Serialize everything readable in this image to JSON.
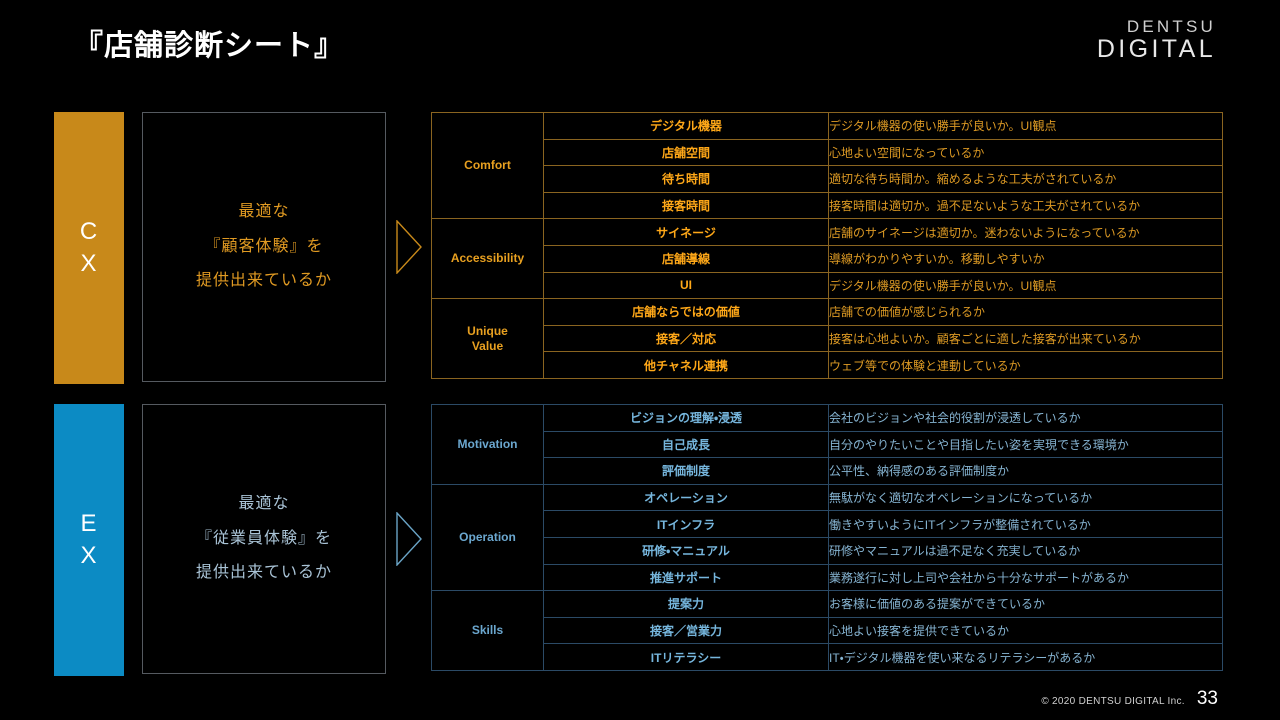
{
  "header": {
    "title": "『店舗診断シート』",
    "logo_top": "DENTSU",
    "logo_bottom": "DIGITAL"
  },
  "sections": [
    {
      "key": "cx",
      "axis_label_line1": "C",
      "axis_label_line2": "X",
      "accent_color": "#c8891a",
      "statement": [
        "最適な",
        "『顧客体験』を",
        "提供出来ているか"
      ],
      "groups": [
        {
          "category": "Comfort",
          "rows": [
            {
              "item": "デジタル機器",
              "desc": "デジタル機器の使い勝手が良いか。UI観点"
            },
            {
              "item": "店舗空間",
              "desc": "心地よい空間になっているか"
            },
            {
              "item": "待ち時間",
              "desc": "適切な待ち時間か。縮めるような工夫がされているか"
            },
            {
              "item": "接客時間",
              "desc": "接客時間は適切か。過不足ないような工夫がされているか"
            }
          ]
        },
        {
          "category": "Accessibility",
          "rows": [
            {
              "item": "サイネージ",
              "desc": "店舗のサイネージは適切か。迷わないようになっているか"
            },
            {
              "item": "店舗導線",
              "desc": "導線がわかりやすいか。移動しやすいか"
            },
            {
              "item": "UI",
              "desc": "デジタル機器の使い勝手が良いか。UI観点"
            }
          ]
        },
        {
          "category": "Unique\nValue",
          "rows": [
            {
              "item": "店舗ならではの価値",
              "desc": "店舗での価値が感じられるか"
            },
            {
              "item": "接客／対応",
              "desc": "接客は心地よいか。顧客ごとに適した接客が出来ているか"
            },
            {
              "item": "他チャネル連携",
              "desc": "ウェブ等での体験と連動しているか"
            }
          ]
        }
      ]
    },
    {
      "key": "ex",
      "axis_label_line1": "E",
      "axis_label_line2": "X",
      "accent_color": "#0c8bc4",
      "statement": [
        "最適な",
        "『従業員体験』を",
        "提供出来ているか"
      ],
      "groups": [
        {
          "category": "Motivation",
          "rows": [
            {
              "item": "ビジョンの理解・浸透",
              "desc": "会社のビジョンや社会的役割が浸透しているか"
            },
            {
              "item": "自己成長",
              "desc": "自分のやりたいことや目指したい姿を実現できる環境か"
            },
            {
              "item": "評価制度",
              "desc": "公平性、納得感のある評価制度か"
            }
          ]
        },
        {
          "category": "Operation",
          "rows": [
            {
              "item": "オペレーション",
              "desc": "無駄がなく適切なオペレーションになっているか"
            },
            {
              "item": "ITインフラ",
              "desc": "働きやすいようにITインフラが整備されているか"
            },
            {
              "item": "研修・マニュアル",
              "desc": "研修やマニュアルは過不足なく充実しているか"
            },
            {
              "item": "推進サポート",
              "desc": "業務遂行に対し上司や会社から十分なサポートがあるか"
            }
          ]
        },
        {
          "category": "Skills",
          "rows": [
            {
              "item": "提案力",
              "desc": "お客様に価値のある提案ができているか"
            },
            {
              "item": "接客／営業力",
              "desc": "心地よい接客を提供できているか"
            },
            {
              "item": "ITリテラシー",
              "desc": "IT・デジタル機器を使い来なるリテラシーがあるか"
            }
          ]
        }
      ]
    }
  ],
  "footer": {
    "copyright": "© 2020 DENTSU DIGITAL Inc.",
    "page_number": "33"
  }
}
